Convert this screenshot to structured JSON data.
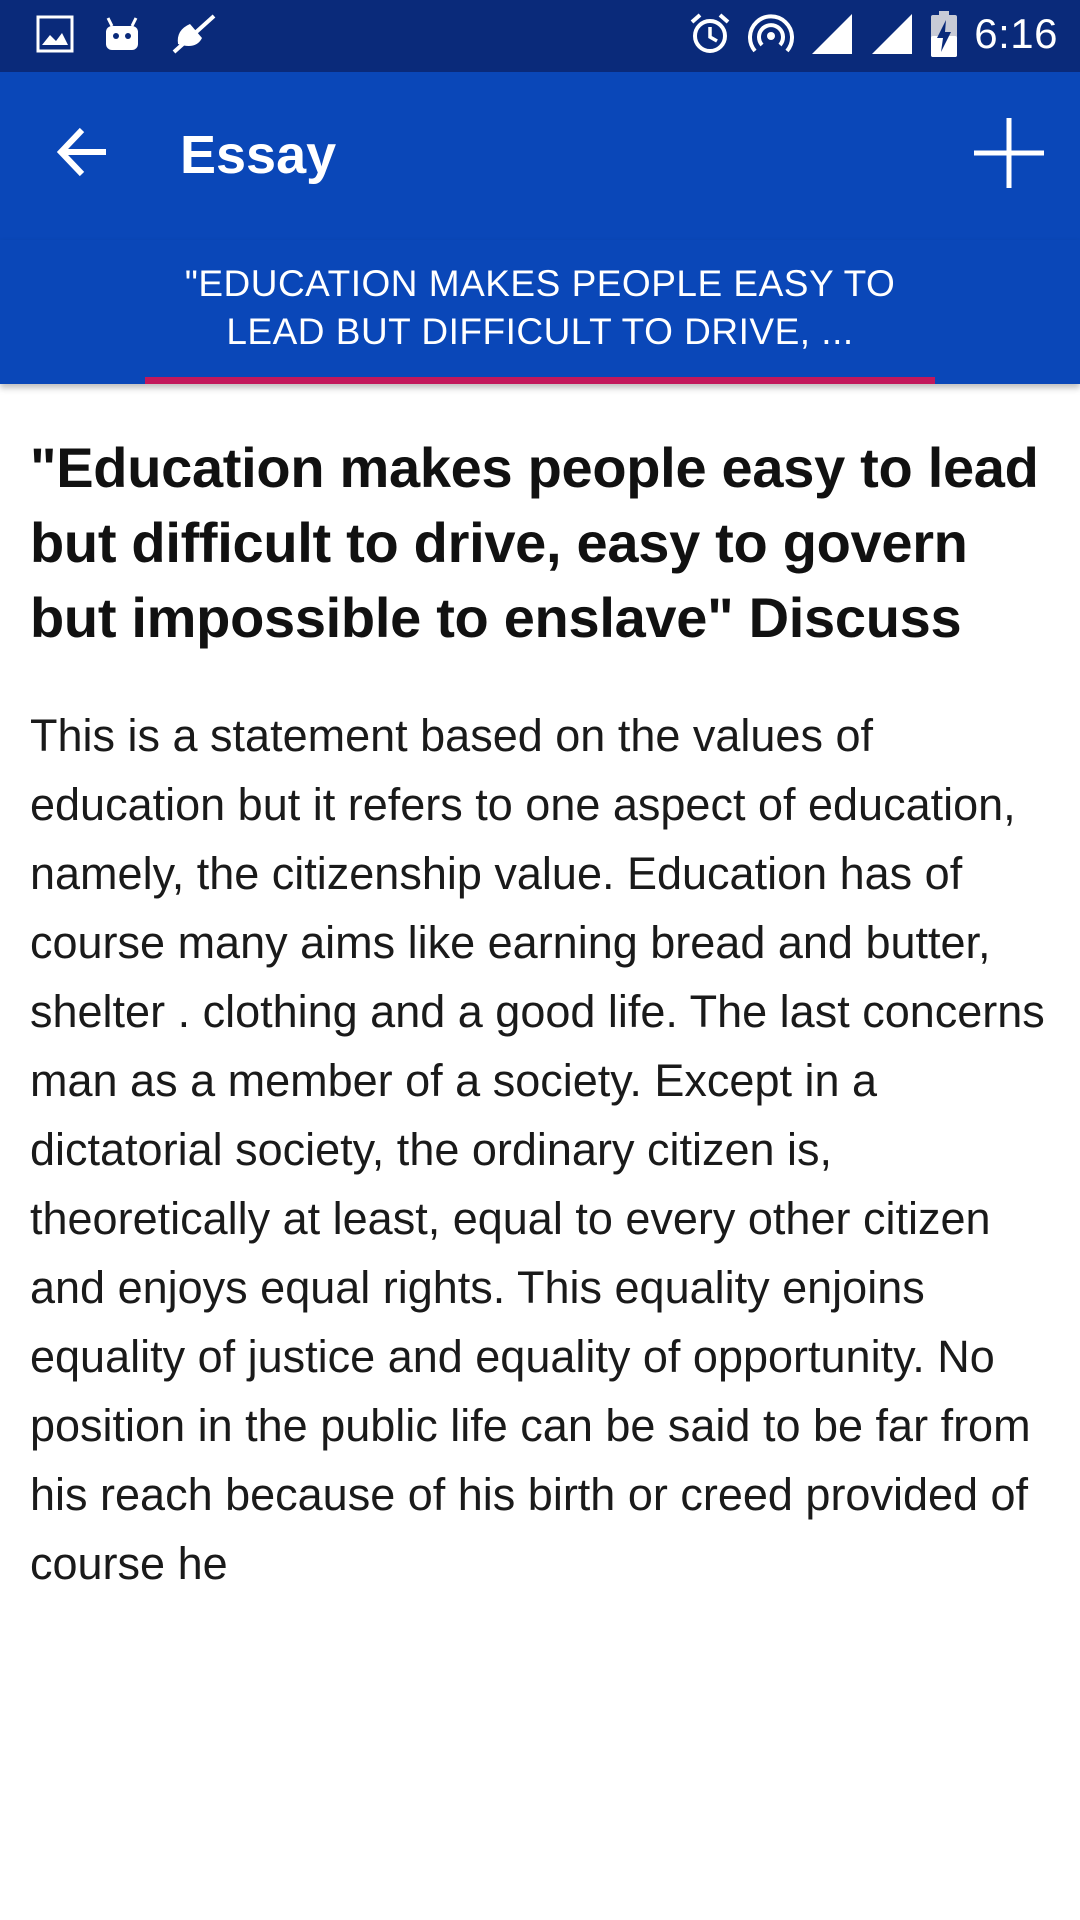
{
  "status_bar": {
    "time": "6:16",
    "left_icons": [
      "image-icon",
      "android-icon",
      "mute-icon"
    ],
    "right_icons": [
      "alarm-icon",
      "hotspot-icon",
      "signal-icon",
      "signal-icon",
      "battery-charging-icon"
    ]
  },
  "app_bar": {
    "title": "Essay",
    "back_icon": "arrow-left-icon",
    "action_icon": "plus-icon",
    "background": "#0a47b8"
  },
  "tabs": [
    {
      "label": "\"EDUCATION MAKES PEOPLE EASY TO LEAD BUT DIFFICULT TO DRIVE, ...",
      "selected": true
    }
  ],
  "colors": {
    "status_bar": "#0a2a7a",
    "primary": "#0a47b8",
    "tab_indicator": "#c2185b",
    "text": "#111111"
  },
  "article": {
    "title": "\"Education makes people easy to lead but difficult to drive, easy to govern but impossible to enslave\" Discuss",
    "body": "This is a statement based on the values of education but it refers to one aspect of education, namely, the citizenship value. Education has of course many aims like earning bread and butter, shelter . clothing and a good life. The last concerns man as a member of a society. Except in a dictatorial society, the ordinary citizen is, theoretically at least, equal to every other citizen and enjoys equal rights. This equality enjoins equality of justice and equality of opportunity. No position in the public life can be said to be far from his reach because of his birth or creed provided of course he"
  }
}
